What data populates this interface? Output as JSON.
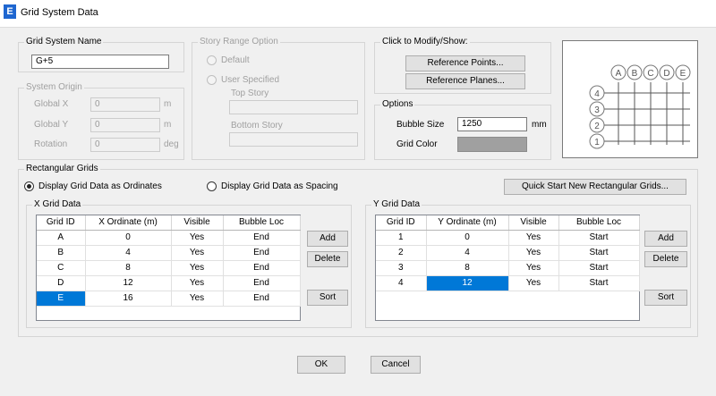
{
  "window": {
    "title": "Grid System Data",
    "logo_letter": "E"
  },
  "grid_system_name": {
    "label": "Grid System Name",
    "value": "G+5"
  },
  "story_range": {
    "label": "Story Range Option",
    "default_label": "Default",
    "user_specified_label": "User Specified",
    "top_story_label": "Top Story",
    "top_story_value": "",
    "bottom_story_label": "Bottom Story",
    "bottom_story_value": ""
  },
  "system_origin": {
    "label": "System Origin",
    "fields": [
      {
        "label": "Global  X",
        "value": "0",
        "unit": "m"
      },
      {
        "label": "Global  Y",
        "value": "0",
        "unit": "m"
      },
      {
        "label": "Rotation",
        "value": "0",
        "unit": "deg"
      }
    ]
  },
  "modify_show": {
    "label": "Click to Modify/Show:",
    "reference_points": "Reference Points...",
    "reference_planes": "Reference Planes..."
  },
  "options": {
    "label": "Options",
    "bubble_size_label": "Bubble Size",
    "bubble_size_value": "1250",
    "bubble_size_unit": "mm",
    "grid_color_label": "Grid Color",
    "grid_color": "#a0a0a0"
  },
  "preview": {
    "x_bubbles": [
      "A",
      "B",
      "C",
      "D",
      "E"
    ],
    "y_bubbles": [
      "4",
      "3",
      "2",
      "1"
    ]
  },
  "rectangular_grids": {
    "label": "Rectangular Grids",
    "ordinates_label": "Display Grid Data as Ordinates",
    "spacing_label": "Display Grid Data as Spacing",
    "quick_start_label": "Quick Start New Rectangular Grids..."
  },
  "x_grid": {
    "label": "X Grid Data",
    "headers": [
      "Grid ID",
      "X Ordinate (m)",
      "Visible",
      "Bubble Loc"
    ],
    "rows": [
      [
        "A",
        "0",
        "Yes",
        "End"
      ],
      [
        "B",
        "4",
        "Yes",
        "End"
      ],
      [
        "C",
        "8",
        "Yes",
        "End"
      ],
      [
        "D",
        "12",
        "Yes",
        "End"
      ],
      [
        "E",
        "16",
        "Yes",
        "End"
      ]
    ]
  },
  "y_grid": {
    "label": "Y Grid Data",
    "headers": [
      "Grid ID",
      "Y Ordinate (m)",
      "Visible",
      "Bubble Loc"
    ],
    "rows": [
      [
        "1",
        "0",
        "Yes",
        "Start"
      ],
      [
        "2",
        "4",
        "Yes",
        "Start"
      ],
      [
        "3",
        "8",
        "Yes",
        "Start"
      ],
      [
        "4",
        "12",
        "Yes",
        "Start"
      ]
    ]
  },
  "buttons": {
    "add": "Add",
    "delete": "Delete",
    "sort": "Sort",
    "ok": "OK",
    "cancel": "Cancel"
  }
}
